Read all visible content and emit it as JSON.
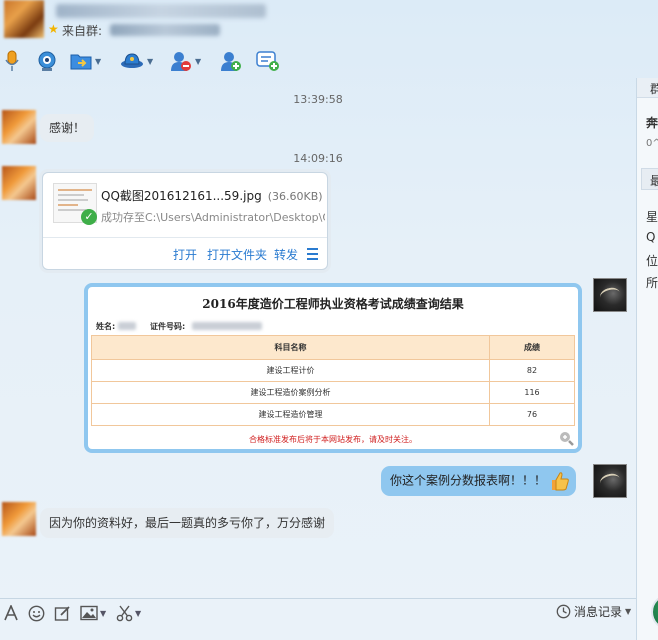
{
  "header": {
    "source_prefix": "来自群:"
  },
  "chat": {
    "timestamp_1": "13:39:58",
    "msg_1": "感谢！",
    "timestamp_2": "14:09:16",
    "file": {
      "name": "QQ截图201612161...59.jpg",
      "size": "(36.60KB)",
      "status": "成功存至C:\\Users\\Administrator\\Desktop\\QQ...",
      "action_open": "打开",
      "action_open_folder": "打开文件夹",
      "action_forward": "转发"
    },
    "image": {
      "title": "2016年度造价工程师执业资格考试成绩查询结果",
      "name_label": "姓名:",
      "id_label": "证件号码:",
      "col_subject": "科目名称",
      "col_score": "成绩",
      "rows": [
        {
          "subject": "建设工程计价",
          "score": "82"
        },
        {
          "subject": "建设工程造价案例分析",
          "score": "116"
        },
        {
          "subject": "建设工程造价管理",
          "score": "76"
        }
      ],
      "note": "合格标准发布后将于本网站发布，请及时关注。"
    },
    "msg_2": "你这个案例分数报表啊！！！",
    "msg_3": "因为你的资料好，最后一题真的多亏你了，万分感谢"
  },
  "side_panel": {
    "items": [
      "群",
      "奔",
      "0^",
      "最",
      "星",
      "Q",
      "位",
      "所"
    ]
  },
  "input_bar": {
    "history_label": "消息记录"
  },
  "colors": {
    "my_bubble": "#8fc7ef",
    "other_bubble": "#e7edf2",
    "link": "#2a7bd0"
  }
}
